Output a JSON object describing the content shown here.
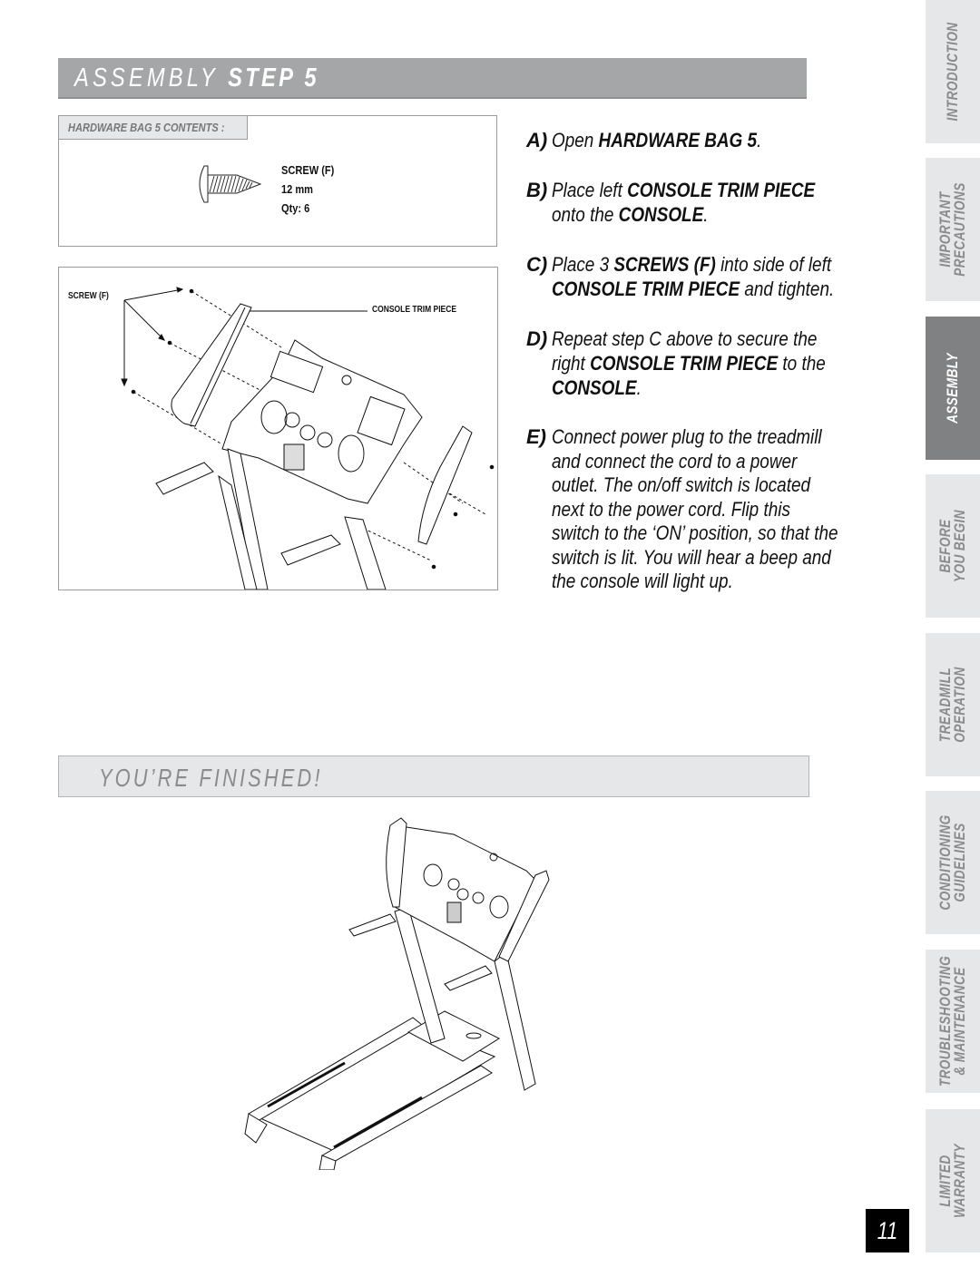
{
  "header": {
    "title_light": "ASSEMBLY",
    "title_bold": "STEP 5"
  },
  "hardware": {
    "label": "HARDWARE BAG 5 CONTENTS :",
    "item_icon": "screw-icon",
    "item_name": "SCREW (F)",
    "item_size": "12 mm",
    "item_qty": "Qty: 6"
  },
  "diagram": {
    "callout_screw": "SCREW (F)",
    "callout_trim": "CONSOLE TRIM PIECE"
  },
  "instructions": [
    {
      "letter": "A)",
      "parts": [
        {
          "t": "Open "
        },
        {
          "b": "HARDWARE BAG 5"
        },
        {
          "t": "."
        }
      ]
    },
    {
      "letter": "B)",
      "parts": [
        {
          "t": "Place left "
        },
        {
          "b": "CONSOLE TRIM PIECE"
        },
        {
          "t": " onto the "
        },
        {
          "b": "CONSOLE"
        },
        {
          "t": "."
        }
      ]
    },
    {
      "letter": "C)",
      "parts": [
        {
          "t": "Place 3 "
        },
        {
          "b": "SCREWS (F)"
        },
        {
          "t": " into side of left "
        },
        {
          "b": "CONSOLE TRIM PIECE"
        },
        {
          "t": " and tighten."
        }
      ]
    },
    {
      "letter": "D)",
      "parts": [
        {
          "t": "Repeat step C above to secure the right "
        },
        {
          "b": "CONSOLE TRIM PIECE"
        },
        {
          "t": " to the "
        },
        {
          "b": "CONSOLE"
        },
        {
          "t": "."
        }
      ]
    },
    {
      "letter": "E)",
      "parts": [
        {
          "t": "Connect power plug to the treadmill and connect the cord to a power outlet. The on/off switch is located next to the power cord. Flip this switch to the ‘ON’ position, so that the switch is lit. You will hear a beep and the console will light up."
        }
      ]
    }
  ],
  "finished": {
    "label": "YOU’RE FINISHED!"
  },
  "side_tabs": [
    {
      "lines": [
        "INTRODUCTION"
      ],
      "active": false
    },
    {
      "lines": [
        "IMPORTANT",
        "PRECAUTIONS"
      ],
      "active": false
    },
    {
      "lines": [
        "ASSEMBLY"
      ],
      "active": true
    },
    {
      "lines": [
        "BEFORE",
        "YOU BEGIN"
      ],
      "active": false
    },
    {
      "lines": [
        "TREADMILL",
        "OPERATION"
      ],
      "active": false
    },
    {
      "lines": [
        "CONDITIONING",
        "GUIDELINES"
      ],
      "active": false
    },
    {
      "lines": [
        "TROUBLESHOOTING",
        "& MAINTENANCE"
      ],
      "active": false
    },
    {
      "lines": [
        "LIMITED",
        "WARRANTY"
      ],
      "active": false
    }
  ],
  "page_number": "11",
  "colors": {
    "header_bg": "#a5a6a8",
    "tab_bg": "#e6e7e8",
    "tab_active_bg": "#808183",
    "tab_text": "#8a8b8d"
  }
}
